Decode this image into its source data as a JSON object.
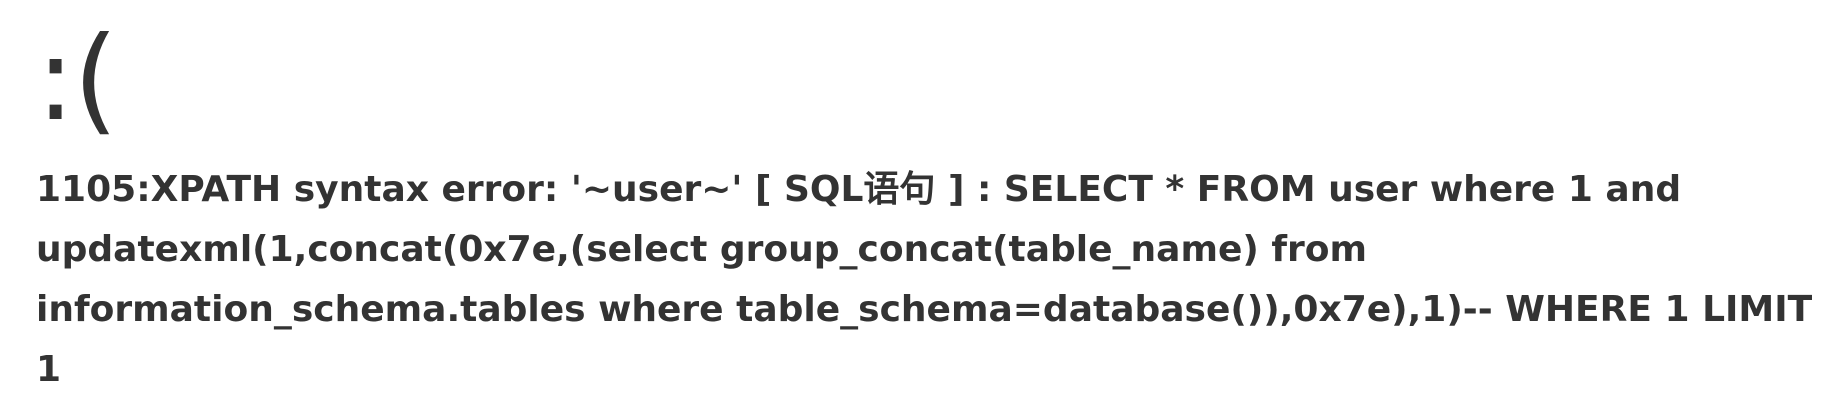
{
  "page": {
    "face": ":(",
    "message": "1105:XPATH syntax error: '~user~' [ SQL语句 ] : SELECT * FROM user where 1 and updatexml(1,concat(0x7e,(select group_concat(table_name) from information_schema.tables where table_schema=database()),0x7e),1)-- WHERE 1 LIMIT 1"
  }
}
